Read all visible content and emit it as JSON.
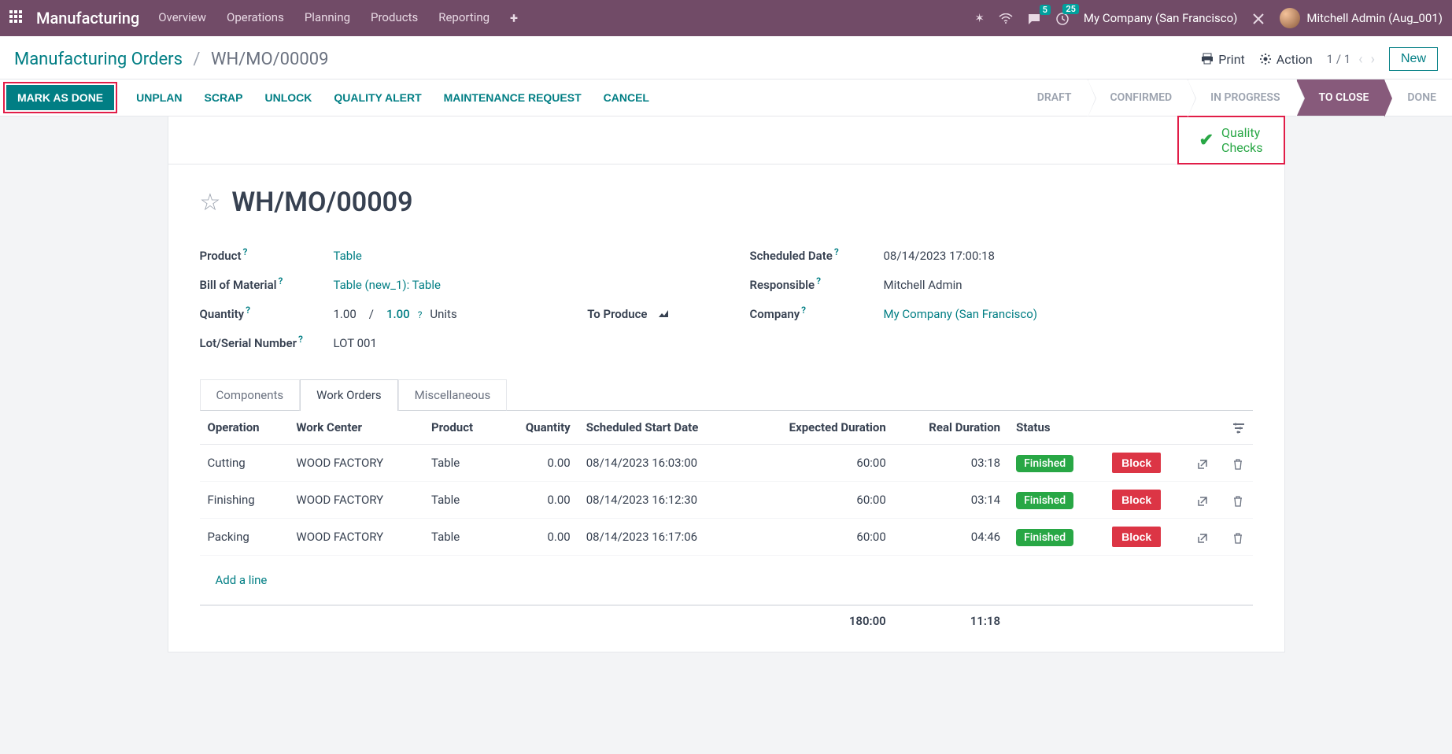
{
  "nav": {
    "brand": "Manufacturing",
    "menu": [
      "Overview",
      "Operations",
      "Planning",
      "Products",
      "Reporting"
    ],
    "chat_badge": "5",
    "activity_badge": "25",
    "company": "My Company (San Francisco)",
    "user": "Mitchell Admin (Aug_001)"
  },
  "control": {
    "breadcrumb_root": "Manufacturing Orders",
    "breadcrumb_current": "WH/MO/00009",
    "print": "Print",
    "action": "Action",
    "pager": "1 / 1",
    "new": "New"
  },
  "actionbar": {
    "mark_done": "MARK AS DONE",
    "unplan": "UNPLAN",
    "scrap": "SCRAP",
    "unlock": "UNLOCK",
    "quality_alert": "QUALITY ALERT",
    "maintenance_request": "MAINTENANCE REQUEST",
    "cancel": "CANCEL",
    "status": {
      "draft": "DRAFT",
      "confirmed": "CONFIRMED",
      "in_progress": "IN PROGRESS",
      "to_close": "TO CLOSE",
      "done": "DONE"
    }
  },
  "quality": {
    "line1": "Quality",
    "line2": "Checks"
  },
  "form": {
    "title": "WH/MO/00009",
    "labels": {
      "product": "Product",
      "bom": "Bill of Material",
      "quantity": "Quantity",
      "lot_serial": "Lot/Serial Number",
      "scheduled_date": "Scheduled Date",
      "responsible": "Responsible",
      "company": "Company",
      "to_produce": "To Produce",
      "units": "Units"
    },
    "values": {
      "product": "Table",
      "bom": "Table (new_1): Table",
      "qty": "1.00",
      "qty_target": "1.00",
      "lot_serial": "LOT 001",
      "scheduled_date": "08/14/2023 17:00:18",
      "responsible": "Mitchell Admin",
      "company": "My Company (San Francisco)"
    }
  },
  "tabs": {
    "components": "Components",
    "work_orders": "Work Orders",
    "misc": "Miscellaneous"
  },
  "table": {
    "headers": {
      "operation": "Operation",
      "work_center": "Work Center",
      "product": "Product",
      "quantity": "Quantity",
      "sched_start": "Scheduled Start Date",
      "exp_dur": "Expected Duration",
      "real_dur": "Real Duration",
      "status": "Status"
    },
    "rows": [
      {
        "operation": "Cutting",
        "work_center": "WOOD FACTORY",
        "product": "Table",
        "quantity": "0.00",
        "sched_start": "08/14/2023 16:03:00",
        "exp_dur": "60:00",
        "real_dur": "03:18",
        "status": "Finished",
        "block": "Block"
      },
      {
        "operation": "Finishing",
        "work_center": "WOOD FACTORY",
        "product": "Table",
        "quantity": "0.00",
        "sched_start": "08/14/2023 16:12:30",
        "exp_dur": "60:00",
        "real_dur": "03:14",
        "status": "Finished",
        "block": "Block"
      },
      {
        "operation": "Packing",
        "work_center": "WOOD FACTORY",
        "product": "Table",
        "quantity": "0.00",
        "sched_start": "08/14/2023 16:17:06",
        "exp_dur": "60:00",
        "real_dur": "04:46",
        "status": "Finished",
        "block": "Block"
      }
    ],
    "add_line": "Add a line",
    "totals": {
      "exp_dur": "180:00",
      "real_dur": "11:18"
    }
  }
}
